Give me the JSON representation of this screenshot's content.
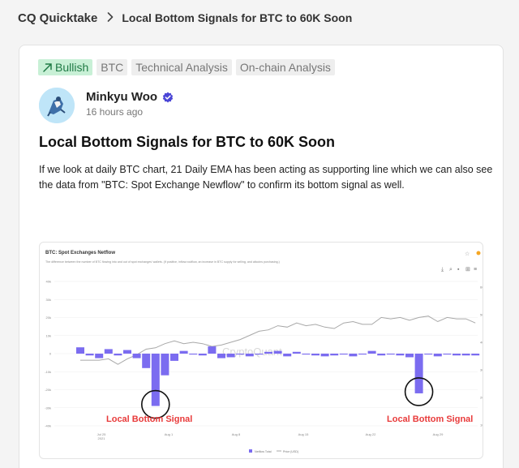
{
  "breadcrumb": {
    "root": "CQ Quicktake",
    "current": "Local Bottom Signals for BTC to 60K Soon"
  },
  "post": {
    "sentiment_label": "Bullish",
    "sentiment_icon": "trending-up-icon",
    "tags": [
      "BTC",
      "Technical Analysis",
      "On-chain Analysis"
    ],
    "author": "Minkyu Woo",
    "time_ago": "16 hours ago",
    "title": "Local Bottom Signals for BTC to 60K Soon",
    "body": "If we look at daily BTC chart, 21 Daily EMA has been acting as supporting line which we can also see the data from \"BTC: Spot Exchange Newflow\" to confirm  its bottom signal as well."
  },
  "colors": {
    "bullish_bg": "#c8f0d6",
    "bullish_text": "#1f7a45",
    "bar": "#7b6cf0",
    "price_line": "#a8a8a8",
    "annotation": "#e83a3a"
  },
  "chart_data": {
    "type": "bar",
    "title": "BTC: Spot Exchanges Netflow",
    "subtitle": "The difference between the number of BTC flowing into and out of spot exchanges' wallets. (If positive, inflow>outflow, an increase in BTC supply for selling, and altcoins purchasing.)",
    "watermark": "CryptoQuant",
    "y_left": {
      "ticks": [
        "40k",
        "30k",
        "20k",
        "10k",
        "0",
        "-10k",
        "-20k",
        "-30k",
        "-40k"
      ],
      "range": [
        -40000,
        40000
      ]
    },
    "y_right": {
      "ticks": [
        "60k",
        "50k",
        "40k",
        "30k",
        "20k",
        "10k"
      ],
      "range": [
        10000,
        60000
      ]
    },
    "x_ticks": [
      "Jul 25\n2021",
      "Aug 1",
      "Aug 8",
      "Aug 15",
      "Aug 22",
      "Aug 29"
    ],
    "series": [
      {
        "name": "Netflow Total",
        "type": "bar",
        "values": [
          3500,
          -1000,
          -2500,
          2500,
          -1000,
          2000,
          -2500,
          -8000,
          -29000,
          -12000,
          -4000,
          1500,
          -500,
          -1000,
          4000,
          -2500,
          -2000,
          -500,
          -1500,
          -500,
          1000,
          1500,
          -1500,
          1000,
          -500,
          -1000,
          -1500,
          -1000,
          -500,
          -1500,
          -500,
          1500,
          -1000,
          -500,
          -1000,
          -2000,
          -22000,
          -500,
          -1500,
          -500,
          -1000,
          -1000,
          -1000
        ]
      },
      {
        "name": "Price (USD)",
        "type": "line",
        "values": [
          33500,
          33500,
          33500,
          34000,
          32000,
          34000,
          35500,
          37500,
          38000,
          39500,
          40500,
          39500,
          40000,
          39500,
          38500,
          39000,
          40000,
          41000,
          42500,
          44000,
          44500,
          46000,
          45500,
          47000,
          46000,
          46500,
          45500,
          45000,
          47000,
          47500,
          46500,
          46500,
          49000,
          48500,
          49000,
          48000,
          49000,
          49500,
          47500,
          49000,
          48500,
          48500,
          47000
        ]
      }
    ],
    "legend": "bottom-center",
    "annotations": [
      "Local Bottom Signal",
      "Local Bottom Signal"
    ]
  }
}
